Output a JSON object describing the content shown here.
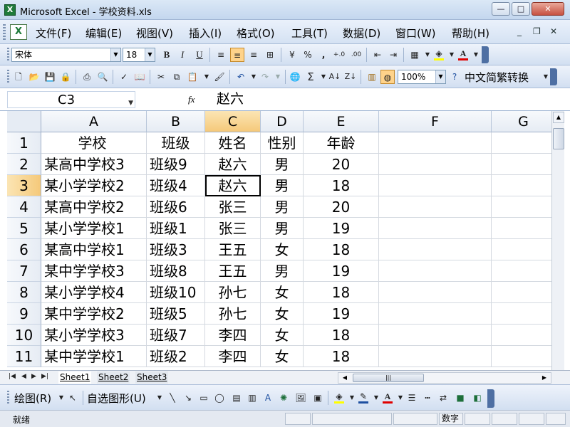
{
  "window": {
    "title": "Microsoft Excel - 学校资料.xls",
    "app_icon": "excel-app-icon",
    "controls": {
      "minimize": "—",
      "maximize": "□",
      "close": "✕"
    }
  },
  "menubar": {
    "items": [
      "文件(F)",
      "编辑(E)",
      "视图(V)",
      "插入(I)",
      "格式(O)",
      "工具(T)",
      "数据(D)",
      "窗口(W)",
      "帮助(H)"
    ],
    "doc_controls": {
      "minimize": "_",
      "restore": "❐",
      "close": "✕"
    }
  },
  "format_toolbar": {
    "font": "宋体",
    "size": "18",
    "bold": "B",
    "italic": "I",
    "underline": "U",
    "percent": "%",
    "comma": ",",
    "inc_decimal": "+.0",
    "dec_decimal": ".00"
  },
  "standard_toolbar": {
    "sum": "Σ",
    "zoom": "100%",
    "convert": "中文简繁转换"
  },
  "formula_bar": {
    "name_box": "C3",
    "fx": "fx",
    "value": "赵六"
  },
  "grid": {
    "columns": [
      "A",
      "B",
      "C",
      "D",
      "E",
      "F",
      "G"
    ],
    "selected_column": "C",
    "selected_row": "3",
    "rows": [
      {
        "num": "1",
        "cells": [
          "学校",
          "班级",
          "姓名",
          "性别",
          "年龄"
        ]
      },
      {
        "num": "2",
        "cells": [
          "某高中学校3",
          "班级9",
          "赵六",
          "男",
          "20"
        ]
      },
      {
        "num": "3",
        "cells": [
          "某小学学校2",
          "班级4",
          "赵六",
          "男",
          "18"
        ]
      },
      {
        "num": "4",
        "cells": [
          "某高中学校2",
          "班级6",
          "张三",
          "男",
          "20"
        ]
      },
      {
        "num": "5",
        "cells": [
          "某小学学校1",
          "班级1",
          "张三",
          "男",
          "19"
        ]
      },
      {
        "num": "6",
        "cells": [
          "某高中学校1",
          "班级3",
          "王五",
          "女",
          "18"
        ]
      },
      {
        "num": "7",
        "cells": [
          "某中学学校3",
          "班级8",
          "王五",
          "男",
          "19"
        ]
      },
      {
        "num": "8",
        "cells": [
          "某小学学校4",
          "班级10",
          "孙七",
          "女",
          "18"
        ]
      },
      {
        "num": "9",
        "cells": [
          "某中学学校2",
          "班级5",
          "孙七",
          "女",
          "19"
        ]
      },
      {
        "num": "10",
        "cells": [
          "某小学学校3",
          "班级7",
          "李四",
          "女",
          "18"
        ]
      },
      {
        "num": "11",
        "cells": [
          "某中学学校1",
          "班级2",
          "李四",
          "女",
          "18"
        ]
      }
    ]
  },
  "sheets": [
    "Sheet1",
    "Sheet2",
    "Sheet3"
  ],
  "drawing_toolbar": {
    "draw": "绘图(R)",
    "autoshapes": "自选图形(U)"
  },
  "status": {
    "left": "就绪",
    "right": "数字"
  },
  "colors": {
    "selection_header": "#f5c97a",
    "toolbar_bg": "#d5e2f3",
    "font_color_bar": "#e00000",
    "fill_color_bar": "#ffff00"
  }
}
